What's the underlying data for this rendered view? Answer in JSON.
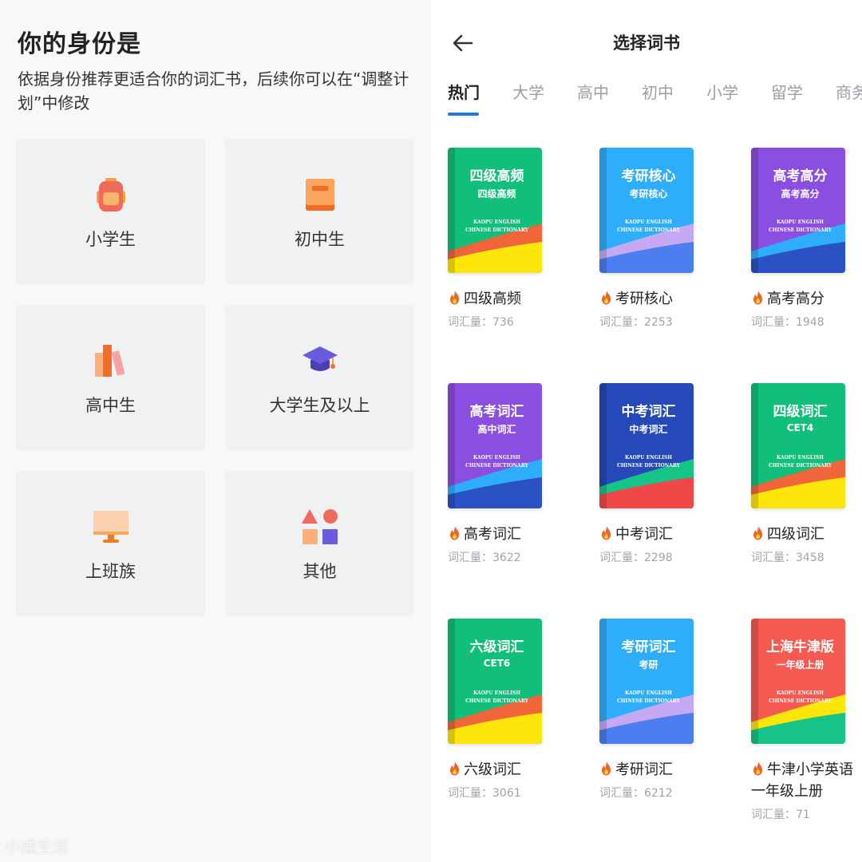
{
  "identity": {
    "title": "你的身份是",
    "subtitle": "依据身份推荐更适合你的词汇书，后续你可以在“调整计划”中修改",
    "roles": [
      {
        "label": "小学生",
        "icon": "backpack-icon"
      },
      {
        "label": "初中生",
        "icon": "book-icon"
      },
      {
        "label": "高中生",
        "icon": "books-icon"
      },
      {
        "label": "大学生及以上",
        "icon": "graduation-cap-icon"
      },
      {
        "label": "上班族",
        "icon": "monitor-icon"
      },
      {
        "label": "其他",
        "icon": "shapes-icon"
      }
    ],
    "watermark": "小成生活"
  },
  "book_select": {
    "title": "选择词书",
    "back_icon": "arrow-left-icon",
    "tabs": [
      "热门",
      "大学",
      "高中",
      "初中",
      "小学",
      "留学",
      "商务"
    ],
    "active_tab": "热门",
    "count_prefix": "词汇量：",
    "cover_brand_line1": "KAOPU ENGLISH",
    "cover_brand_line2": "CHINESE DICTIONARY",
    "books": [
      {
        "cover_title": "四级高频",
        "cover_sub": "四级高频",
        "name": "四级高频",
        "count": "736",
        "colors": {
          "bg": "#12bf7a",
          "w1": "#f0663a",
          "w2": "#ffe60a"
        }
      },
      {
        "cover_title": "考研核心",
        "cover_sub": "考研核心",
        "name": "考研核心",
        "count": "2253",
        "colors": {
          "bg": "#2eaefa",
          "w1": "#c6a8f5",
          "w2": "#4c7ef0"
        }
      },
      {
        "cover_title": "高考高分",
        "cover_sub": "高考高分",
        "name": "高考高分",
        "count": "1948",
        "colors": {
          "bg": "#8a4fe0",
          "w1": "#2eaefa",
          "w2": "#2a52c4"
        }
      },
      {
        "cover_title": "高考词汇",
        "cover_sub": "高中词汇",
        "name": "高考词汇",
        "count": "3622",
        "colors": {
          "bg": "#8a4fe0",
          "w1": "#2eaefa",
          "w2": "#2a52c4"
        }
      },
      {
        "cover_title": "中考词汇",
        "cover_sub": "中考词汇",
        "name": "中考词汇",
        "count": "2298",
        "colors": {
          "bg": "#2549b8",
          "w1": "#16c488",
          "w2": "#f04848"
        }
      },
      {
        "cover_title": "四级词汇",
        "cover_sub": "CET4",
        "name": "四级词汇",
        "count": "3458",
        "colors": {
          "bg": "#12bf7a",
          "w1": "#f0663a",
          "w2": "#ffe60a"
        }
      },
      {
        "cover_title": "六级词汇",
        "cover_sub": "CET6",
        "name": "六级词汇",
        "count": "3061",
        "colors": {
          "bg": "#12bf7a",
          "w1": "#f0663a",
          "w2": "#ffe60a"
        }
      },
      {
        "cover_title": "考研词汇",
        "cover_sub": "考研",
        "name": "考研词汇",
        "count": "6212",
        "colors": {
          "bg": "#2eaefa",
          "w1": "#c6a8f5",
          "w2": "#4c7ef0"
        }
      },
      {
        "cover_title": "上海牛津版",
        "cover_sub": "一年级上册",
        "name": "牛津小学英语一年级上册",
        "count": "71",
        "colors": {
          "bg": "#f45a50",
          "w1": "#ffe60a",
          "w2": "#16c488"
        }
      }
    ]
  }
}
